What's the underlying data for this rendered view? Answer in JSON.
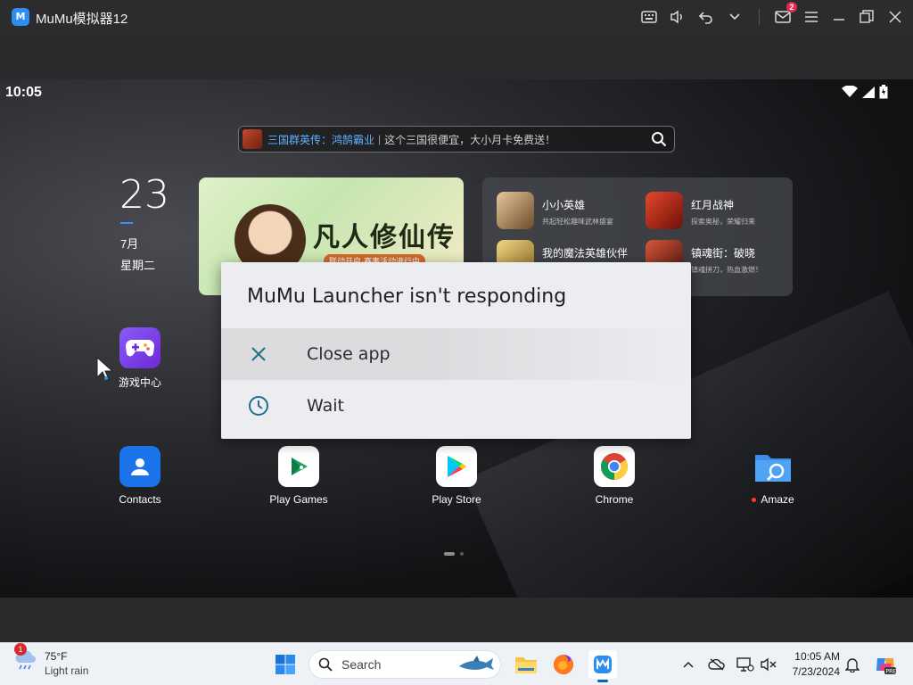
{
  "emulator": {
    "title": "MuMu模拟器12",
    "logo_text": "M",
    "mail_badge": "2"
  },
  "status_bar": {
    "time": "10:05"
  },
  "search_bar": {
    "promo": "三国群英传：鸿鹄霸业",
    "divider": "|",
    "text": "这个三国很便宜，大小月卡免费送！"
  },
  "clock": {
    "day": "23",
    "month": "7月",
    "weekday": "星期二"
  },
  "banner": {
    "title": "凡人修仙传",
    "subtitle": "联动开启·赛事活动进行中"
  },
  "games": [
    {
      "name": "小小英雄",
      "desc": "共起轻松趣味武林盛宴",
      "color": "#6b4b2a"
    },
    {
      "name": "红月战神",
      "desc": "探索奥秘，荣耀归来",
      "color": "#a8261c"
    },
    {
      "name": "我的魔法英雄伙伴",
      "desc": "",
      "color": "#c9a14b"
    },
    {
      "name": "镇魂街：破晓",
      "desc": "镇魂拼刀，热血激燃！",
      "color": "#7a2a1d"
    }
  ],
  "apps": {
    "game_center": "游戏中心",
    "contacts": "Contacts",
    "play_games": "Play Games",
    "play_store": "Play Store",
    "chrome": "Chrome",
    "amaze": "Amaze"
  },
  "dialog": {
    "title": "MuMu Launcher isn't responding",
    "close_app": "Close app",
    "wait": "Wait"
  },
  "taskbar": {
    "weather_temp": "75°F",
    "weather_desc": "Light rain",
    "weather_badge": "1",
    "search_label": "Search",
    "time": "10:05 AM",
    "date": "7/23/2024"
  },
  "colors": {
    "accent_blue": "#2b8ef0",
    "dialog_icon": "#1f6f8b"
  }
}
